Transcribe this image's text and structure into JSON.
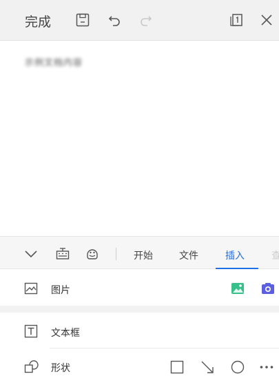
{
  "toolbar": {
    "done_label": "完成"
  },
  "document": {
    "blurred_text": "示例文档内容"
  },
  "panel": {
    "tabs": [
      {
        "label": "开始"
      },
      {
        "label": "文件"
      },
      {
        "label": "插入"
      },
      {
        "label": "查"
      }
    ],
    "active_tab": "插入",
    "rows": [
      {
        "label": "图片"
      },
      {
        "label": "文本框"
      },
      {
        "label": "形状"
      }
    ]
  },
  "colors": {
    "accent": "#1f6fe5",
    "image_icon": "#37c08a",
    "camera_icon": "#5b5fe0"
  }
}
